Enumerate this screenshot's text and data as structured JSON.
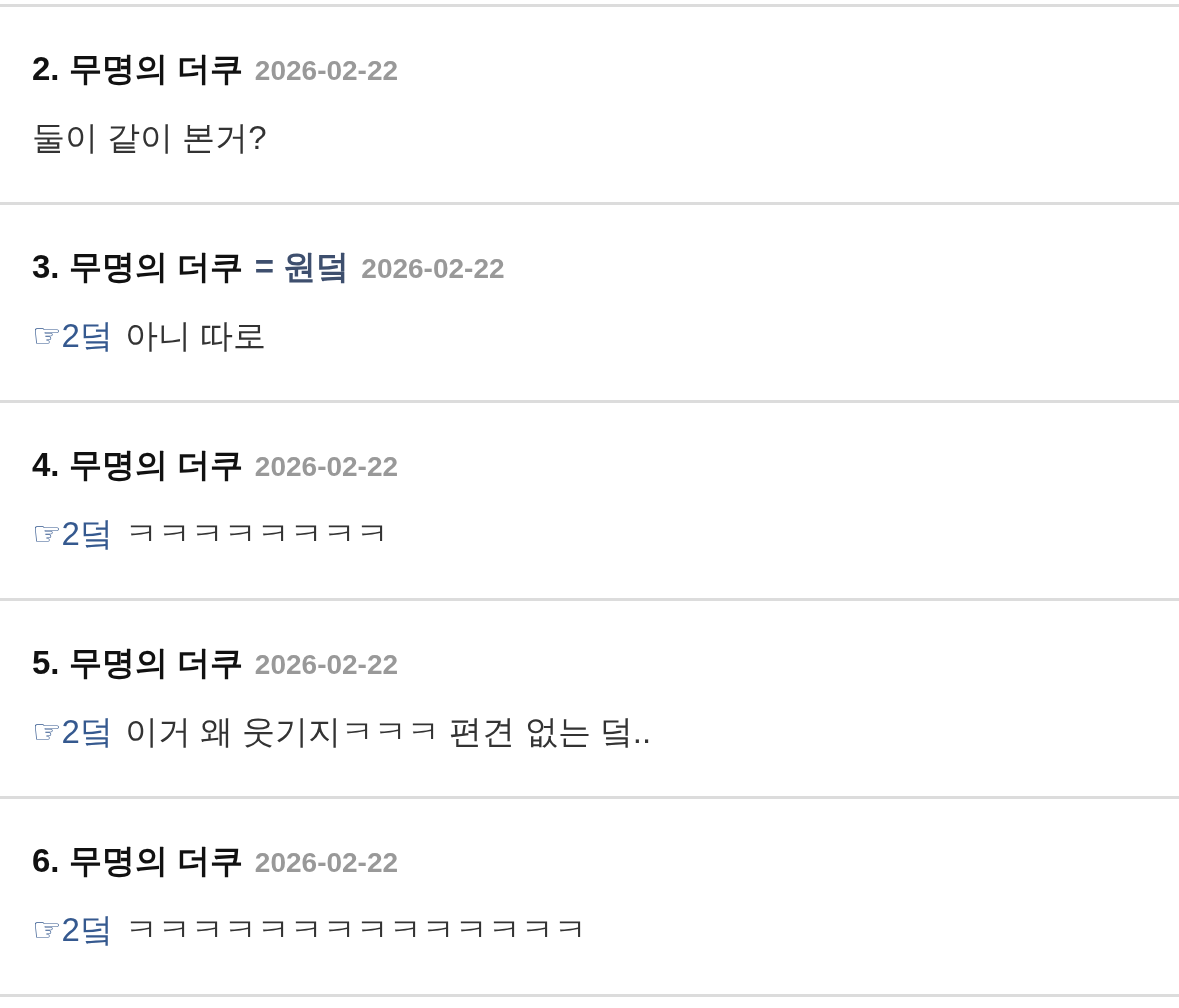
{
  "comments": [
    {
      "number": "2.",
      "author": "무명의 더쿠",
      "date": "2026-02-22",
      "body": "둘이 같이 본거?"
    },
    {
      "number": "3.",
      "author": "무명의 더쿠",
      "author_tag": "= 원덬",
      "date": "2026-02-22",
      "reply_to": "☞2덬",
      "body": "아니 따로"
    },
    {
      "number": "4.",
      "author": "무명의 더쿠",
      "date": "2026-02-22",
      "reply_to": "☞2덬",
      "body": "ㅋㅋㅋㅋㅋㅋㅋㅋ"
    },
    {
      "number": "5.",
      "author": "무명의 더쿠",
      "date": "2026-02-22",
      "reply_to": "☞2덬",
      "body": "이거 왜 웃기지ㅋㅋㅋ 편견 없는 덬.."
    },
    {
      "number": "6.",
      "author": "무명의 더쿠",
      "date": "2026-02-22",
      "reply_to": "☞2덬",
      "body": "ㅋㅋㅋㅋㅋㅋㅋㅋㅋㅋㅋㅋㅋㅋ"
    }
  ]
}
